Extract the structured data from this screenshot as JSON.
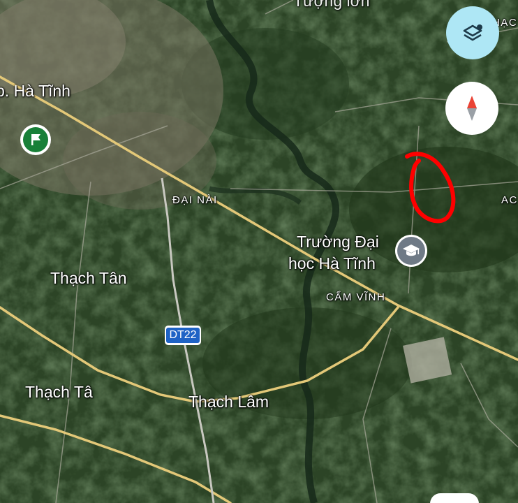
{
  "labels": {
    "top_partial": "Tượng lơn",
    "city": "p. Hà Tĩnh",
    "dai_nai": "ĐẠI NÀI",
    "university_line1": "Trường Đại",
    "university_line2": "học Hà Tĩnh",
    "cam_vinh": "CẨM VĨNH",
    "thach_tan": "Thạch Tân",
    "thach_ta": "Thạch Tâ",
    "thach_lam": "Thạch Lâm",
    "right_top_partial": "HẠC",
    "right_mid_partial": "AC"
  },
  "road_shield": "DT22",
  "icons": {
    "layers": "layers-icon",
    "compass": "compass-icon",
    "pin": "flag-pin-icon",
    "university": "graduation-cap-icon"
  },
  "colors": {
    "road": "#e3c878",
    "annotation": "#ff0000",
    "layers_bg": "#aee7f5",
    "pin_green": "#188038"
  }
}
